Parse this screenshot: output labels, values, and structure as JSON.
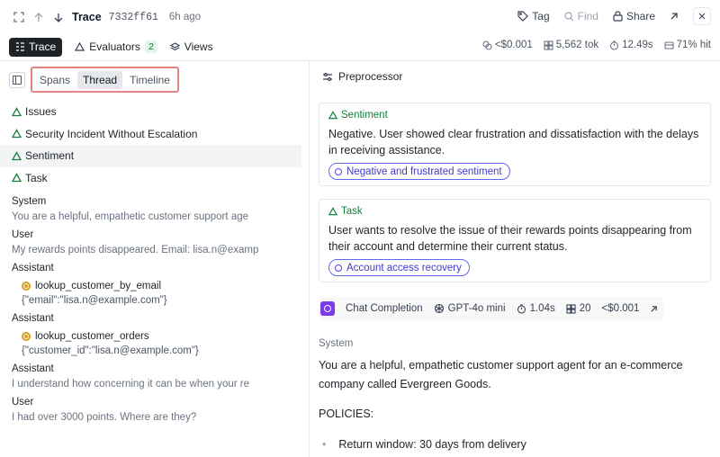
{
  "topbar": {
    "title": "Trace",
    "hash": "7332ff61",
    "ago": "6h ago",
    "actions": {
      "tag": "Tag",
      "find": "Find",
      "share": "Share"
    }
  },
  "secondbar": {
    "trace_label": "Trace",
    "evaluators_label": "Evaluators",
    "evaluators_count": "2",
    "views_label": "Views",
    "stats": {
      "cost": "<$0.001",
      "tokens": "5,562 tok",
      "time": "12.49s",
      "hit": "71% hit"
    }
  },
  "left": {
    "tabs": [
      "Spans",
      "Thread",
      "Timeline"
    ],
    "evals": [
      "Issues",
      "Security Incident Without Escalation",
      "Sentiment",
      "Task"
    ],
    "messages": {
      "system_role": "System",
      "system_text": "You are a helpful, empathetic customer support age",
      "user1_role": "User",
      "user1_text": "My rewards points disappeared. Email: lisa.n@examp",
      "asst1_role": "Assistant",
      "tool1_name": "lookup_customer_by_email",
      "tool1_args": "{\"email\":\"lisa.n@example.com\"}",
      "asst2_role": "Assistant",
      "tool2_name": "lookup_customer_orders",
      "tool2_args": "{\"customer_id\":\"lisa.n@example.com\"}",
      "asst3_role": "Assistant",
      "asst3_text": "I understand how concerning it can be when your re",
      "user2_role": "User",
      "user2_text": "I had over 3000 points. Where are they?"
    }
  },
  "right": {
    "header": "Preprocessor",
    "sentiment": {
      "label": "Sentiment",
      "text": "Negative. User showed clear frustration and dissatisfaction with the delays in receiving assistance.",
      "pill": "Negative and frustrated sentiment"
    },
    "task": {
      "label": "Task",
      "text": "User wants to resolve the issue of their rewards points disappearing from their account and determine their current status.",
      "pill": "Account access recovery"
    },
    "completion": {
      "label": "Chat Completion",
      "model": "GPT-4o mini",
      "time": "1.04s",
      "tokens": "20",
      "cost": "<$0.001"
    },
    "system_label": "System",
    "system_text": "You are a helpful, empathetic customer support agent for an e-commerce company called Evergreen Goods.",
    "policies": "POLICIES:",
    "bullet": "Return window: 30 days from delivery"
  },
  "colors": {
    "accent_green": "#15803d",
    "pill_indigo": "#4338ca",
    "highlight_red": "#e58383",
    "completion_purple": "#7c3aed"
  }
}
